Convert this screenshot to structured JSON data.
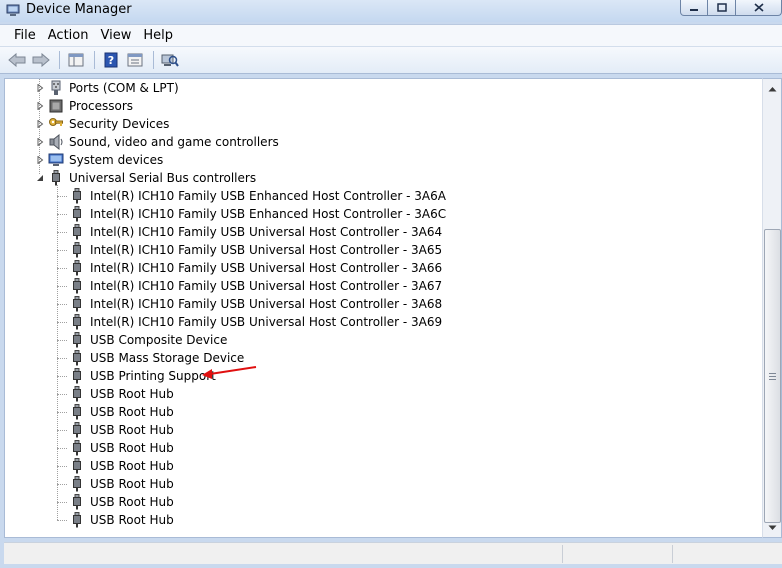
{
  "window": {
    "title": "Device Manager"
  },
  "menu": [
    "File",
    "Action",
    "View",
    "Help"
  ],
  "tree": {
    "categories": [
      {
        "label": "Ports (COM & LPT)",
        "icon": "port-icon",
        "expanded": false
      },
      {
        "label": "Processors",
        "icon": "processor-icon",
        "expanded": false
      },
      {
        "label": "Security Devices",
        "icon": "key-icon",
        "expanded": false
      },
      {
        "label": "Sound, video and game controllers",
        "icon": "speaker-icon",
        "expanded": false
      },
      {
        "label": "System devices",
        "icon": "monitor-icon",
        "expanded": false
      },
      {
        "label": "Universal Serial Bus controllers",
        "icon": "usb-plug-icon",
        "expanded": true
      }
    ],
    "usb_children": [
      "Intel(R) ICH10 Family USB Enhanced Host Controller - 3A6A",
      "Intel(R) ICH10 Family USB Enhanced Host Controller - 3A6C",
      "Intel(R) ICH10 Family USB Universal Host Controller - 3A64",
      "Intel(R) ICH10 Family USB Universal Host Controller - 3A65",
      "Intel(R) ICH10 Family USB Universal Host Controller - 3A66",
      "Intel(R) ICH10 Family USB Universal Host Controller - 3A67",
      "Intel(R) ICH10 Family USB Universal Host Controller - 3A68",
      "Intel(R) ICH10 Family USB Universal Host Controller - 3A69",
      "USB Composite Device",
      "USB Mass Storage Device",
      "USB Printing Support",
      "USB Root Hub",
      "USB Root Hub",
      "USB Root Hub",
      "USB Root Hub",
      "USB Root Hub",
      "USB Root Hub",
      "USB Root Hub",
      "USB Root Hub"
    ]
  },
  "colors": {
    "annotation_arrow": "#e01010",
    "window_frame": "#c9d9ee"
  }
}
